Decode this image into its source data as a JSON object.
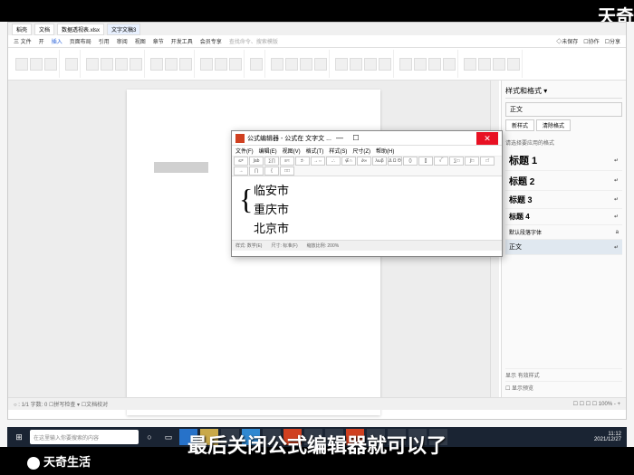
{
  "watermark": {
    "topRight": "天奇",
    "bottomLeft": "天奇生活"
  },
  "subtitle": "最后关闭公式编辑器就可以了",
  "titleBar": {
    "tabs": [
      "稻壳",
      "文档",
      "数据透视表.xlsx",
      "文字文稿3"
    ]
  },
  "menuBar": {
    "items": [
      "三 文件",
      "☐",
      "☐",
      "☐",
      "☐",
      "开",
      "插入",
      "页面布局",
      "引用",
      "审阅",
      "视图",
      "章节",
      "开发工具",
      "会员专享"
    ],
    "search": "查找命令、搜索模版",
    "right": [
      "◇未保存",
      "☐协作",
      "☐分享"
    ]
  },
  "sidePanel": {
    "title": "样式和格式 ▾",
    "currentStyle": "正文",
    "btnNew": "新样式",
    "btnClear": "清除格式",
    "hint": "请选择要应用的格式",
    "styles": [
      {
        "name": "标题 1",
        "checked": true
      },
      {
        "name": "标题 2",
        "checked": true
      },
      {
        "name": "标题 3",
        "checked": true
      },
      {
        "name": "标题 4",
        "checked": true
      },
      {
        "name": "默认段落字体",
        "checked": false
      },
      {
        "name": "正文",
        "checked": true,
        "selected": true
      }
    ],
    "showLabel": "显示  有效样式",
    "showToggle": "☐ 显示预览"
  },
  "formulaEditor": {
    "title": "公式编辑器 - 公式在 文字文 ...",
    "menu": [
      "文件(F)",
      "编辑(E)",
      "视图(V)",
      "格式(T)",
      "样式(S)",
      "尺寸(Z)",
      "帮助(H)"
    ],
    "tools": [
      "≤≠",
      "∫ab",
      "∑∏",
      "≡≈",
      "±∙",
      "→⇔",
      ".∴",
      "∉∩",
      "∂∞",
      "λωβ",
      "Δ Ω Θ"
    ],
    "tools2": [
      "()",
      "[]",
      "√‾",
      "∑□",
      "∫□",
      "□̄",
      "→",
      "∏",
      "{",
      "□□"
    ],
    "content": [
      "临安市",
      "重庆市",
      "北京市"
    ],
    "status": [
      "样式: 数学(E)",
      "尺寸: 标准(F)",
      "缩放比例: 200%"
    ]
  },
  "statusBar": {
    "left": "○ : 1/1  字数: 0  ☐拼写检查 ▾  ☐文档校对",
    "right": "☐ ☐ ☐ ☐ 100% - +"
  },
  "taskbar": {
    "searchPlaceholder": "在这里输入你要搜索的内容",
    "time": "11:12",
    "date": "2021/12/27"
  }
}
